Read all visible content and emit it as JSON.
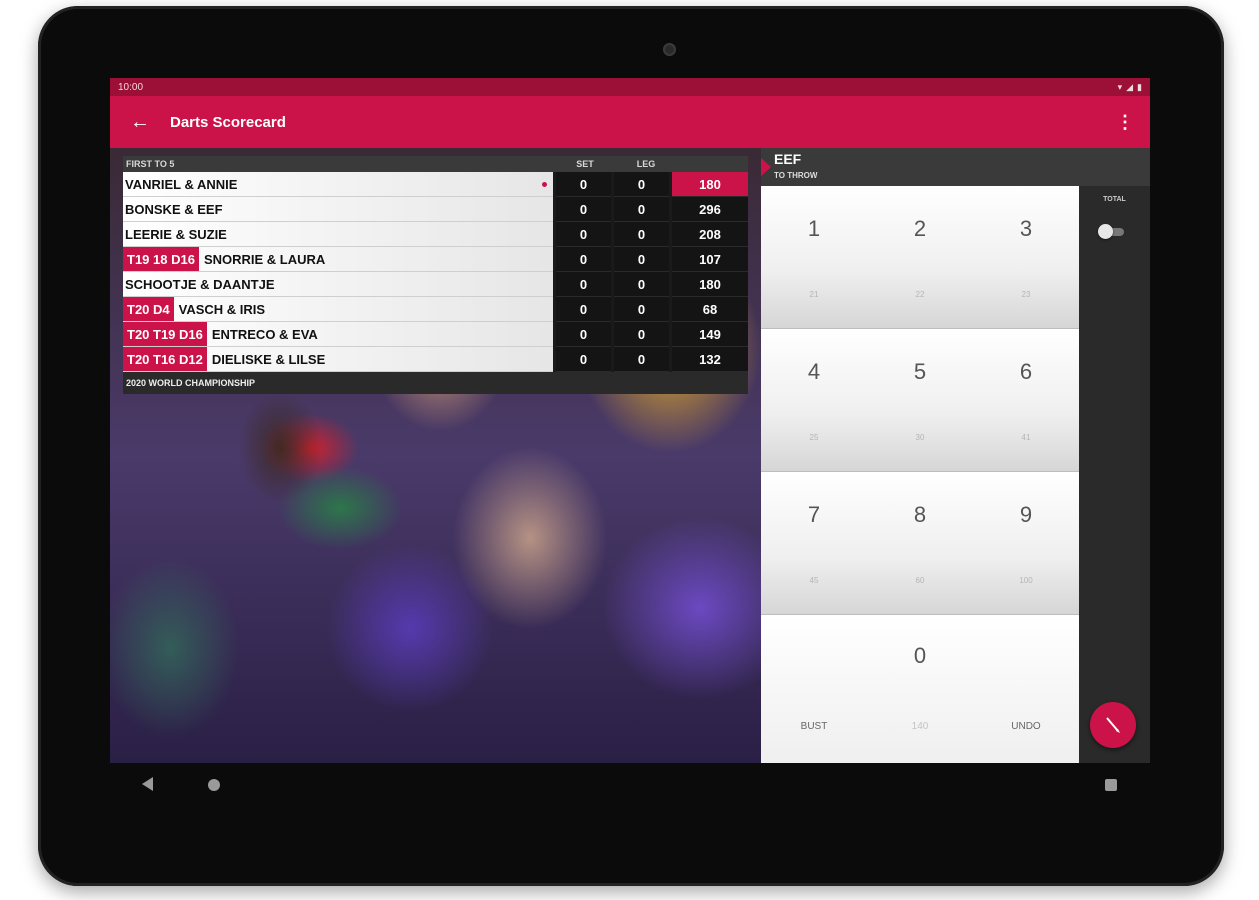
{
  "statusbar": {
    "time": "10:00",
    "icons": "▾ ◢ ▮"
  },
  "appbar": {
    "title": "Darts Scorecard",
    "back_icon": "arrow-left-icon",
    "menu_icon": "more-vert-icon"
  },
  "board": {
    "header": {
      "first_to": "FIRST TO 5",
      "set": "SET",
      "leg": "LEG"
    },
    "players": [
      {
        "checkout": "",
        "name": "VANRIEL & ANNIE",
        "set": "0",
        "leg": "0",
        "score": "180",
        "active": true
      },
      {
        "checkout": "",
        "name": "BONSKE & EEF",
        "set": "0",
        "leg": "0",
        "score": "296",
        "active": false
      },
      {
        "checkout": "",
        "name": "LEERIE & SUZIE",
        "set": "0",
        "leg": "0",
        "score": "208",
        "active": false
      },
      {
        "checkout": "T19 18 D16",
        "name": "SNORRIE & LAURA",
        "set": "0",
        "leg": "0",
        "score": "107",
        "active": false
      },
      {
        "checkout": "",
        "name": "SCHOOTJE & DAANTJE",
        "set": "0",
        "leg": "0",
        "score": "180",
        "active": false
      },
      {
        "checkout": "T20 D4",
        "name": "VASCH & IRIS",
        "set": "0",
        "leg": "0",
        "score": "68",
        "active": false
      },
      {
        "checkout": "T20 T19 D16",
        "name": "ENTRECO & EVA",
        "set": "0",
        "leg": "0",
        "score": "149",
        "active": false
      },
      {
        "checkout": "T20 T16 D12",
        "name": "DIELISKE & LILSE",
        "set": "0",
        "leg": "0",
        "score": "132",
        "active": false
      }
    ],
    "footer": "2020 WORLD CHAMPIONSHIP"
  },
  "thrower": {
    "name": "EEF",
    "subtitle": "TO THROW"
  },
  "keypad": {
    "rows": [
      [
        {
          "big": "1",
          "small": "21"
        },
        {
          "big": "2",
          "small": "22"
        },
        {
          "big": "3",
          "small": "23"
        }
      ],
      [
        {
          "big": "4",
          "small": "25"
        },
        {
          "big": "5",
          "small": "30"
        },
        {
          "big": "6",
          "small": "41"
        }
      ],
      [
        {
          "big": "7",
          "small": "45"
        },
        {
          "big": "8",
          "small": "60"
        },
        {
          "big": "9",
          "small": "100"
        }
      ]
    ],
    "zero": "0",
    "bust": "BUST",
    "middle": "140",
    "undo": "UNDO"
  },
  "sidebar": {
    "total_label": "TOTAL",
    "total_enabled": false
  },
  "colors": {
    "accent": "#cc1349",
    "statusbar": "#9c0f36"
  }
}
